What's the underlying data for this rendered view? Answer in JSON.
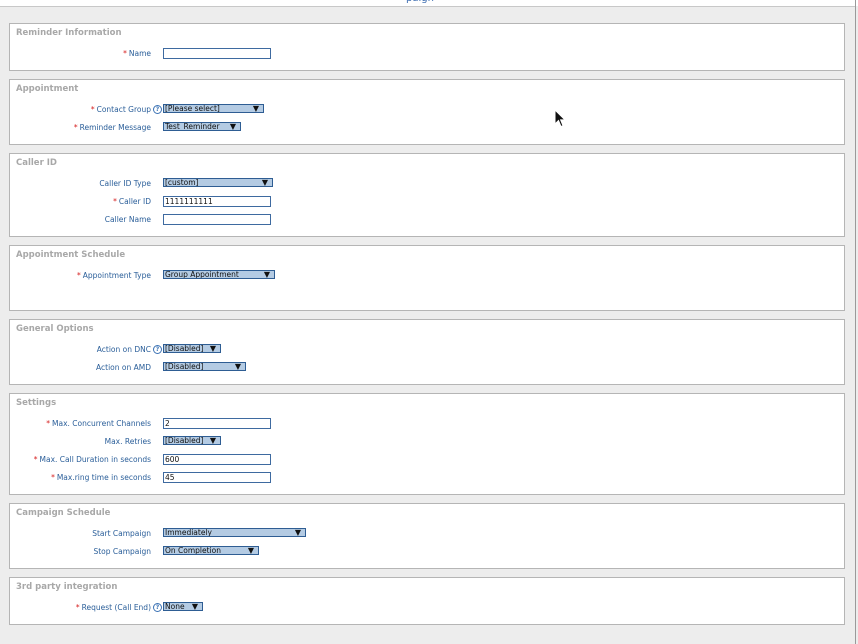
{
  "top_stub": "paign",
  "sections": {
    "reminder": {
      "legend": "Reminder Information",
      "name": {
        "label": "Name",
        "value": ""
      }
    },
    "appointment": {
      "legend": "Appointment",
      "contact_group": {
        "label": "Contact Group",
        "value": "[Please select]"
      },
      "reminder_message": {
        "label": "Reminder Message",
        "value": "Test_Reminder"
      }
    },
    "caller_id": {
      "legend": "Caller ID",
      "caller_id_type": {
        "label": "Caller ID Type",
        "value": "[custom]"
      },
      "caller_id": {
        "label": "Caller ID",
        "value": "1111111111"
      },
      "caller_name": {
        "label": "Caller Name",
        "value": ""
      }
    },
    "schedule": {
      "legend": "Appointment Schedule",
      "appointment_type": {
        "label": "Appointment Type",
        "value": "Group Appointment"
      }
    },
    "general": {
      "legend": "General Options",
      "action_dnc": {
        "label": "Action on DNC",
        "value": "[Disabled]"
      },
      "action_amd": {
        "label": "Action on AMD",
        "value": "[Disabled]"
      }
    },
    "settings": {
      "legend": "Settings",
      "max_channels": {
        "label": "Max. Concurrent Channels",
        "value": "2"
      },
      "max_retries": {
        "label": "Max. Retries",
        "value": "[Disabled]"
      },
      "max_duration": {
        "label": "Max. Call Duration in seconds",
        "value": "600"
      },
      "max_ring": {
        "label": "Max.ring time in seconds",
        "value": "45"
      }
    },
    "campaign": {
      "legend": "Campaign Schedule",
      "start": {
        "label": "Start Campaign",
        "value": "Immediately"
      },
      "stop": {
        "label": "Stop Campaign",
        "value": "On Completion"
      }
    },
    "third_party": {
      "legend": "3rd party integration",
      "request": {
        "label": "Request (Call End)",
        "value": "None"
      }
    }
  },
  "required_marker": "*",
  "help_glyph": "?",
  "arrow_glyph": "▼",
  "colors": {
    "label": "#2a5e99",
    "required": "#d62020",
    "legend": "#a8a8a8",
    "select_bg": "#b4cbe3",
    "input_border": "#3e6aa0"
  }
}
